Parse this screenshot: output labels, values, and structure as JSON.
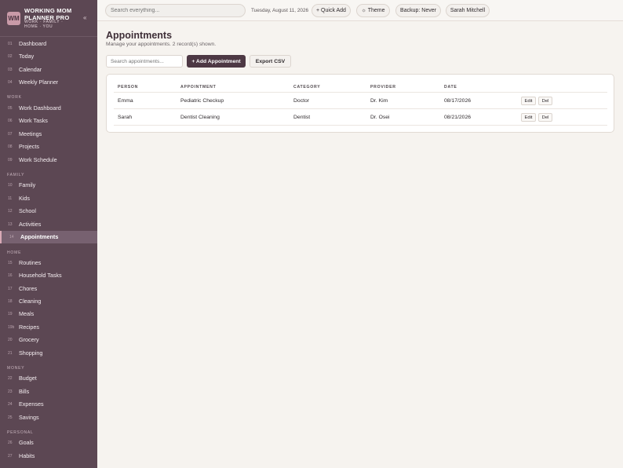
{
  "brand": {
    "logo_text": "WM",
    "title": "WORKING MOM PLANNER PRO",
    "subtitle": "WORK · FAMILY · HOME · YOU",
    "collapse_glyph": "«"
  },
  "sidebar": {
    "top": [
      {
        "num": "01",
        "label": "Dashboard"
      },
      {
        "num": "02",
        "label": "Today"
      },
      {
        "num": "03",
        "label": "Calendar"
      },
      {
        "num": "04",
        "label": "Weekly Planner"
      }
    ],
    "work_label": "WORK",
    "work": [
      {
        "num": "05",
        "label": "Work Dashboard"
      },
      {
        "num": "06",
        "label": "Work Tasks"
      },
      {
        "num": "07",
        "label": "Meetings"
      },
      {
        "num": "08",
        "label": "Projects"
      },
      {
        "num": "09",
        "label": "Work Schedule"
      }
    ],
    "family_label": "FAMILY",
    "family": [
      {
        "num": "10",
        "label": "Family"
      },
      {
        "num": "11",
        "label": "Kids"
      },
      {
        "num": "12",
        "label": "School"
      },
      {
        "num": "13",
        "label": "Activities"
      },
      {
        "num": "14",
        "label": "Appointments"
      }
    ],
    "home_label": "HOME",
    "home": [
      {
        "num": "15",
        "label": "Routines"
      },
      {
        "num": "16",
        "label": "Household Tasks"
      },
      {
        "num": "17",
        "label": "Chores"
      },
      {
        "num": "18",
        "label": "Cleaning"
      },
      {
        "num": "19",
        "label": "Meals"
      },
      {
        "num": "19b",
        "label": "Recipes"
      },
      {
        "num": "20",
        "label": "Grocery"
      },
      {
        "num": "21",
        "label": "Shopping"
      }
    ],
    "money_label": "MONEY",
    "money": [
      {
        "num": "22",
        "label": "Budget"
      },
      {
        "num": "23",
        "label": "Bills"
      },
      {
        "num": "24",
        "label": "Expenses"
      },
      {
        "num": "25",
        "label": "Savings"
      }
    ],
    "personal_label": "PERSONAL",
    "personal": [
      {
        "num": "26",
        "label": "Goals"
      },
      {
        "num": "27",
        "label": "Habits"
      }
    ]
  },
  "topbar": {
    "search_placeholder": "Search everything...",
    "date": "Tuesday, August 11, 2026",
    "quick_add": "+ Quick Add",
    "theme": "☼ Theme",
    "backup": "Backup: Never",
    "user": "Sarah Mitchell"
  },
  "main": {
    "title": "Appointments",
    "subtitle": "Manage your appointments. 2 record(s) shown.",
    "search_placeholder": "Search appointments...",
    "add_button": "+ Add Appointment",
    "export_button": "Export CSV",
    "table": {
      "headers": [
        "PERSON",
        "APPOINTMENT",
        "CATEGORY",
        "PROVIDER",
        "DATE"
      ],
      "rows": [
        {
          "person": "Emma",
          "appointment": "Pediatric Checkup",
          "category": "Doctor",
          "provider": "Dr. Kim",
          "date": "08/17/2026",
          "edit": "Edit",
          "del": "Del"
        },
        {
          "person": "Sarah",
          "appointment": "Dentist Cleaning",
          "category": "Dentist",
          "provider": "Dr. Osei",
          "date": "08/21/2026",
          "edit": "Edit",
          "del": "Del"
        }
      ]
    }
  },
  "colors": {
    "sidebar_bg": "#5c4753",
    "accent": "#4d3844",
    "active_item": "#776170",
    "page_bg": "#f6f3ef"
  }
}
